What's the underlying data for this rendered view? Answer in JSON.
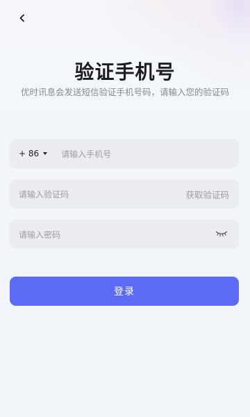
{
  "header": {
    "back_icon": "chevron-left-icon"
  },
  "title": "验证手机号",
  "subtitle": "优时讯息会发送短信验证手机号码，请输入您的验证码",
  "phone": {
    "country_code": "+ 86",
    "caret_icon": "caret-down-icon",
    "placeholder": "请输入手机号"
  },
  "code": {
    "placeholder": "请输入验证码",
    "get_code_label": "获取验证码"
  },
  "password": {
    "placeholder": "请输入密码",
    "eye_icon": "eye-closed-icon"
  },
  "login_button": {
    "label": "登录"
  },
  "colors": {
    "primary": "#5b6bf5",
    "field_bg": "#eaecf1",
    "placeholder": "#9d9da3",
    "title": "#1d1d1f"
  }
}
